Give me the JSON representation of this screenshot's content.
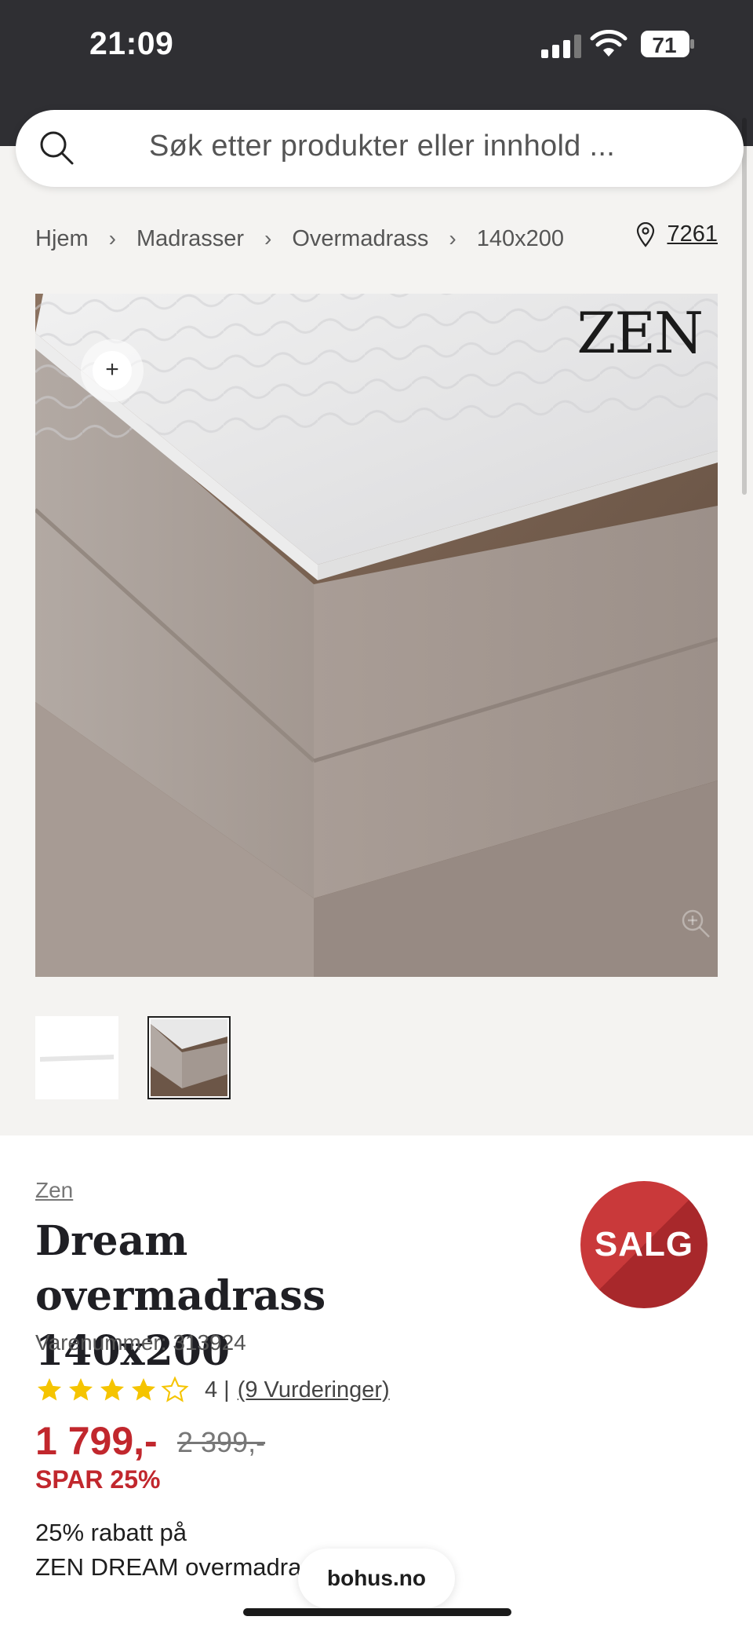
{
  "status": {
    "time": "21:09",
    "battery": "71"
  },
  "search": {
    "placeholder": "Søk etter produkter eller innhold ..."
  },
  "breadcrumb": [
    "Hjem",
    "Madrasser",
    "Overmadrass",
    "140x200"
  ],
  "store": {
    "number": "7261"
  },
  "image": {
    "brand_logo": "ZEN",
    "hotspot_label": "+"
  },
  "product": {
    "brand": "Zen",
    "title_line1": "Dream overmadrass",
    "title_line2": "140x200",
    "sku": "Varenummer: 313924",
    "rating": 4,
    "rating_text": "4 |",
    "reviews": "(9 Vurderinger)",
    "price": "1 799,-",
    "old_price": "2 399,-",
    "save": "SPAR 25%",
    "promo_line1": "25% rabatt på",
    "promo_line2": "ZEN DREAM overmadrass"
  },
  "badge": {
    "label": "SALG"
  },
  "browser": {
    "url": "bohus.no"
  },
  "colors": {
    "sale": "#c1272d",
    "status_bar": "#2f2f33",
    "star": "#f5c400"
  }
}
